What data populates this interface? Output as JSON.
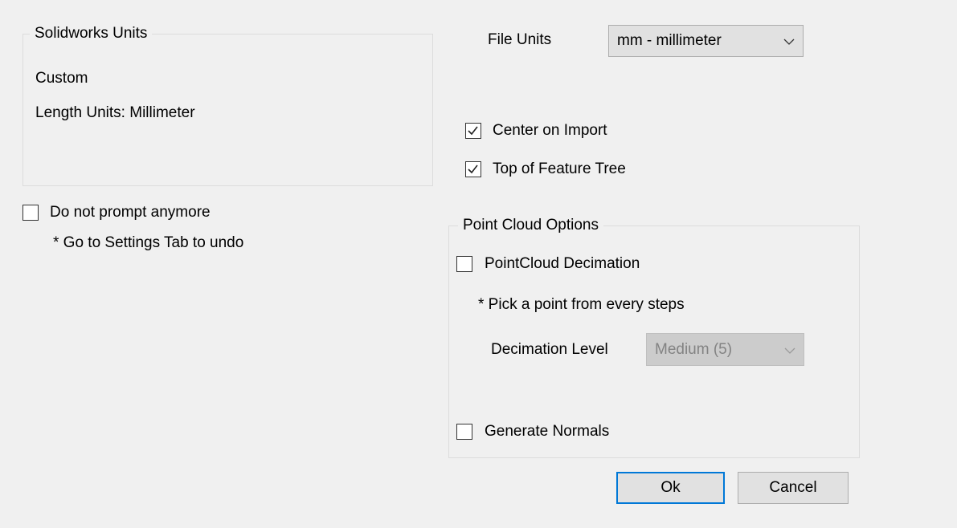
{
  "solidworks_units": {
    "title": "Solidworks Units",
    "system": "Custom",
    "length_units": "Length Units: Millimeter"
  },
  "prompt": {
    "checkbox_label": "Do not prompt anymore",
    "checked": false,
    "hint": "* Go to Settings Tab to undo"
  },
  "file_units": {
    "label": "File Units",
    "selected": "mm - millimeter"
  },
  "options": {
    "center_on_import": {
      "label": "Center on Import",
      "checked": true
    },
    "top_of_feature_tree": {
      "label": "Top of Feature Tree",
      "checked": true
    }
  },
  "point_cloud": {
    "title": "Point Cloud Options",
    "decimation": {
      "label": "PointCloud Decimation",
      "checked": false
    },
    "hint": "* Pick a point from every steps",
    "decimation_level_label": "Decimation Level",
    "decimation_level_value": "Medium (5)",
    "generate_normals": {
      "label": "Generate Normals",
      "checked": false
    }
  },
  "buttons": {
    "ok": "Ok",
    "cancel": "Cancel"
  },
  "colors": {
    "background": "#f0f0f0",
    "default_button_border": "#0078d7"
  }
}
